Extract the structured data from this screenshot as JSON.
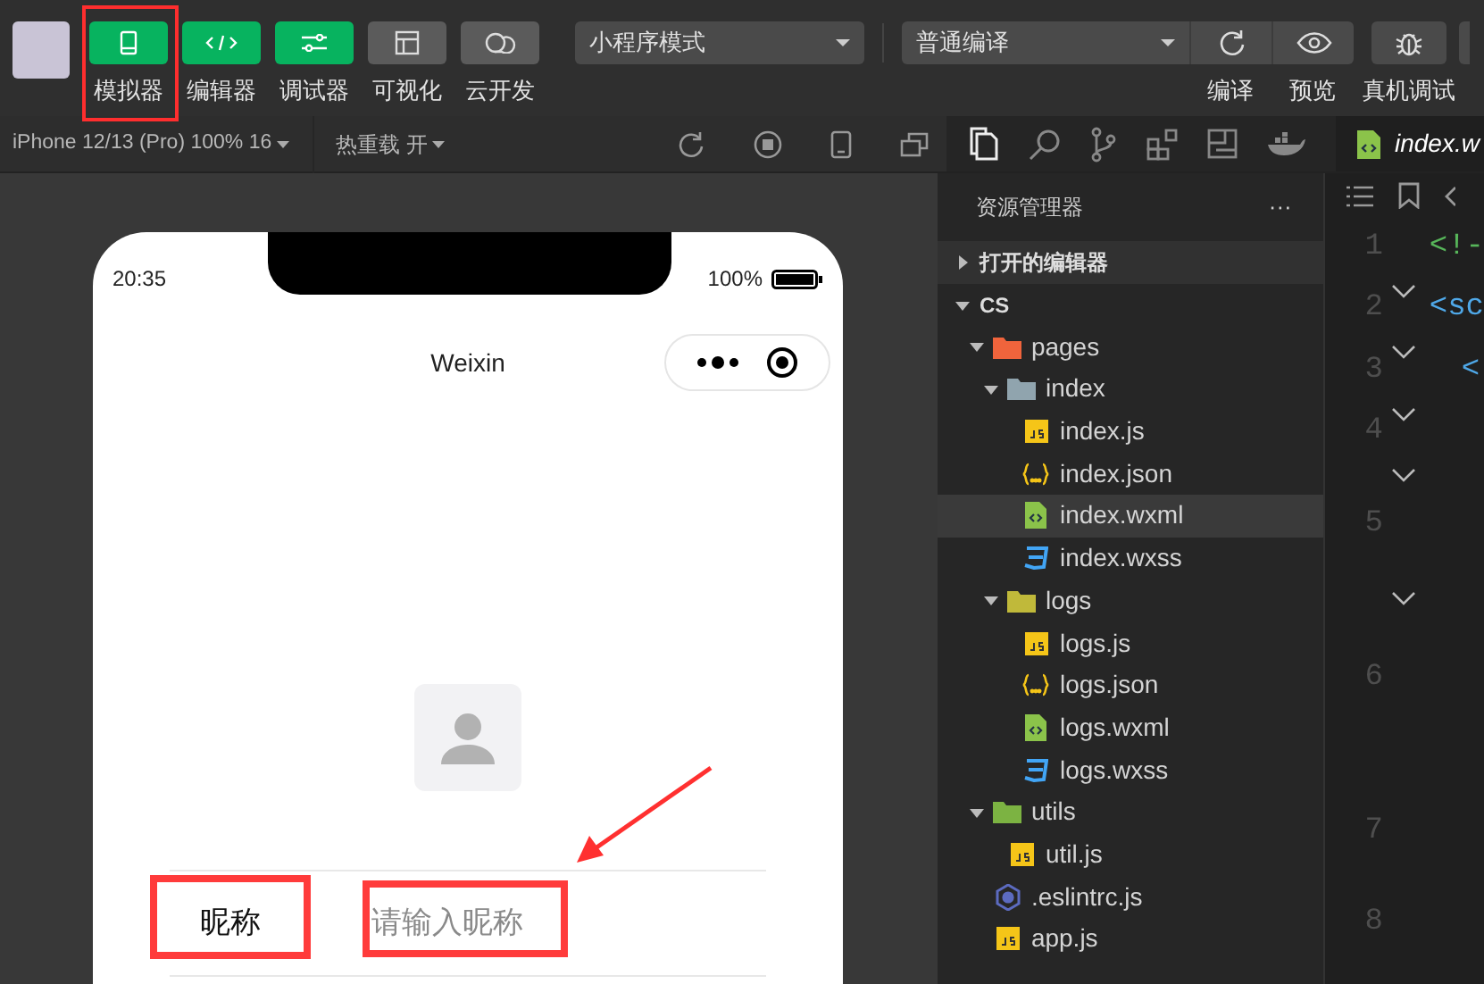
{
  "toolbar": {
    "modes": [
      {
        "label": "模拟器",
        "kind": "phone",
        "on": true,
        "highlighted": true
      },
      {
        "label": "编辑器",
        "kind": "code",
        "on": true
      },
      {
        "label": "调试器",
        "kind": "sliders",
        "on": true
      },
      {
        "label": "可视化",
        "kind": "layout",
        "on": false
      },
      {
        "label": "云开发",
        "kind": "cloud",
        "on": false
      }
    ],
    "mode_select": "小程序模式",
    "compile_select": "普通编译",
    "actions": [
      {
        "label": "编译",
        "kind": "refresh"
      },
      {
        "label": "预览",
        "kind": "eye"
      },
      {
        "label": "真机调试",
        "kind": "bug"
      }
    ]
  },
  "simulator_bar": {
    "device": "iPhone 12/13 (Pro) 100% 16",
    "hot_reload": "热重载 开"
  },
  "phone": {
    "time": "20:35",
    "battery": "100%",
    "title": "Weixin",
    "form": {
      "label": "昵称",
      "label_highlighted": true,
      "placeholder": "请输入昵称",
      "field_highlighted": true,
      "arrow": true
    }
  },
  "explorer": {
    "title": "资源管理器",
    "more": "···",
    "tree": [
      {
        "name": "打开的编辑器",
        "kind": "section",
        "expanded": false
      },
      {
        "name": "CS",
        "kind": "section",
        "expanded": true,
        "children": [
          {
            "name": "pages",
            "kind": "folder",
            "color": "#f0643c",
            "expanded": true,
            "selected": false,
            "children": [
              {
                "name": "index",
                "kind": "folder",
                "color": "#90a4ae",
                "expanded": true,
                "selected": false,
                "children": [
                  {
                    "name": "index.js",
                    "kind": "js",
                    "selected": false
                  },
                  {
                    "name": "index.json",
                    "kind": "json",
                    "selected": false
                  },
                  {
                    "name": "index.wxml",
                    "kind": "wxml",
                    "selected": true
                  },
                  {
                    "name": "index.wxss",
                    "kind": "wxss",
                    "selected": false
                  }
                ]
              },
              {
                "name": "logs",
                "kind": "folder",
                "color": "#c0b93a",
                "expanded": true,
                "selected": false,
                "children": [
                  {
                    "name": "logs.js",
                    "kind": "js",
                    "selected": false
                  },
                  {
                    "name": "logs.json",
                    "kind": "json",
                    "selected": false
                  },
                  {
                    "name": "logs.wxml",
                    "kind": "wxml",
                    "selected": false
                  },
                  {
                    "name": "logs.wxss",
                    "kind": "wxss",
                    "selected": false
                  }
                ]
              }
            ]
          },
          {
            "name": "utils",
            "kind": "folder",
            "color": "#7cb342",
            "expanded": true,
            "selected": false,
            "children": [
              {
                "name": "util.js",
                "kind": "js",
                "selected": false
              }
            ]
          },
          {
            "name": ".eslintrc.js",
            "kind": "eslint",
            "selected": false
          },
          {
            "name": "app.js",
            "kind": "js",
            "selected": false
          }
        ]
      }
    ]
  },
  "editor": {
    "tab": "index.w",
    "lines": [
      {
        "number": "1",
        "text": "<!-",
        "kind": "comment"
      },
      {
        "number": "2",
        "text": "<sc",
        "kind": "tag",
        "foldable": true
      },
      {
        "number": "3",
        "text": "<",
        "kind": "tag",
        "foldable": true
      },
      {
        "number": "4",
        "foldable": true
      },
      {
        "number": "5",
        "foldable": true
      },
      {
        "number": "6",
        "foldable": true
      },
      {
        "number": "7"
      },
      {
        "number": "8"
      }
    ]
  }
}
